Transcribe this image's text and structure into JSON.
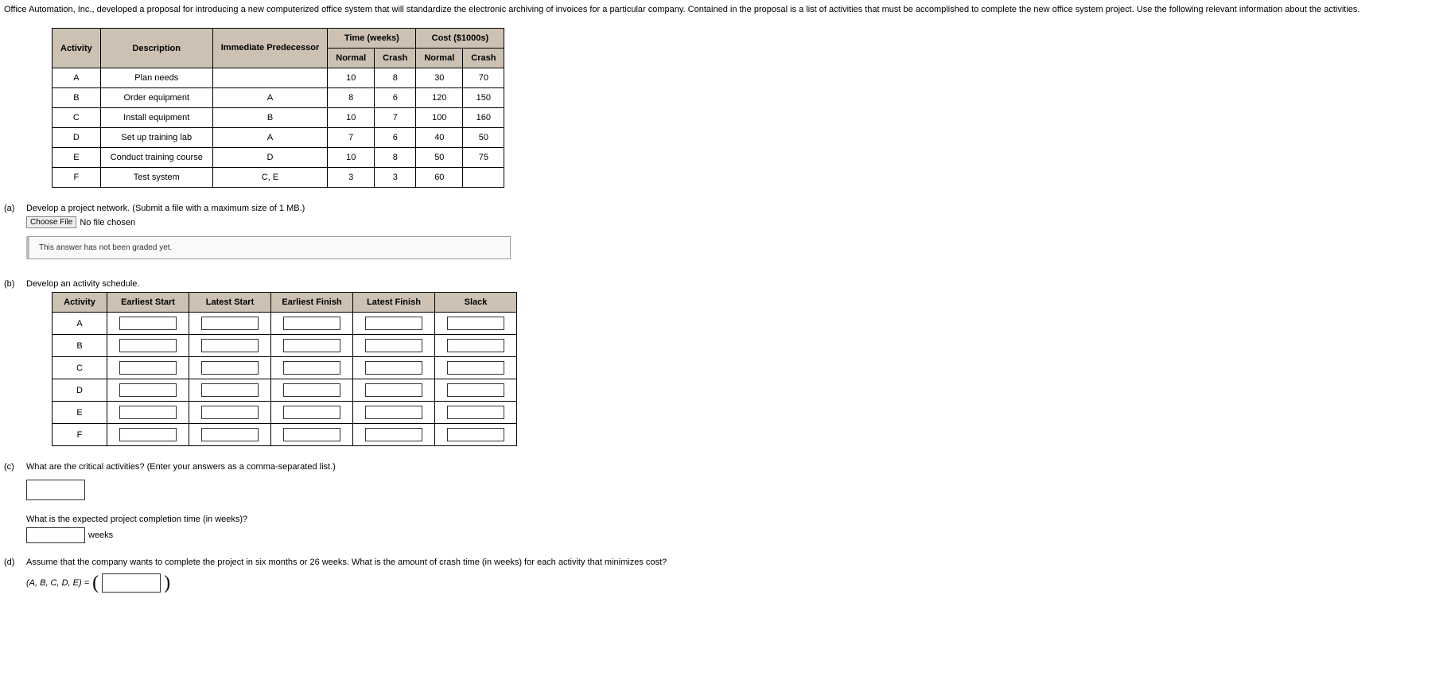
{
  "intro": "Office Automation, Inc., developed a proposal for introducing a new computerized office system that will standardize the electronic archiving of invoices for a particular company. Contained in the proposal is a list of activities that must be accomplished to complete the new office system project. Use the following relevant information about the activities.",
  "table1": {
    "time_header": "Time (weeks)",
    "cost_header": "Cost ($1000s)",
    "col_activity": "Activity",
    "col_description": "Description",
    "col_predecessor": "Immediate Predecessor",
    "col_normal": "Normal",
    "col_crash": "Crash",
    "rows": [
      {
        "act": "A",
        "desc": "Plan needs",
        "pred": "",
        "tn": "10",
        "tc": "8",
        "cn": "30",
        "cc": "70"
      },
      {
        "act": "B",
        "desc": "Order equipment",
        "pred": "A",
        "tn": "8",
        "tc": "6",
        "cn": "120",
        "cc": "150"
      },
      {
        "act": "C",
        "desc": "Install equipment",
        "pred": "B",
        "tn": "10",
        "tc": "7",
        "cn": "100",
        "cc": "160"
      },
      {
        "act": "D",
        "desc": "Set up training lab",
        "pred": "A",
        "tn": "7",
        "tc": "6",
        "cn": "40",
        "cc": "50"
      },
      {
        "act": "E",
        "desc": "Conduct training course",
        "pred": "D",
        "tn": "10",
        "tc": "8",
        "cn": "50",
        "cc": "75"
      },
      {
        "act": "F",
        "desc": "Test system",
        "pred": "C, E",
        "tn": "3",
        "tc": "3",
        "cn": "60",
        "cc": ""
      }
    ]
  },
  "a": {
    "label": "(a)",
    "text": "Develop a project network. (Submit a file with a maximum size of 1 MB.)",
    "choose_file": "Choose File",
    "no_file": "No file chosen",
    "graded_msg": "This answer has not been graded yet."
  },
  "b": {
    "label": "(b)",
    "text": "Develop an activity schedule.",
    "col_activity": "Activity",
    "col_es": "Earliest Start",
    "col_ls": "Latest Start",
    "col_ef": "Earliest Finish",
    "col_lf": "Latest Finish",
    "col_slack": "Slack",
    "activities": [
      "A",
      "B",
      "C",
      "D",
      "E",
      "F"
    ]
  },
  "c": {
    "label": "(c)",
    "text": "What are the critical activities? (Enter your answers as a comma-separated list.)",
    "sub": "What is the expected project completion time (in weeks)?",
    "weeks_unit": "weeks"
  },
  "d": {
    "label": "(d)",
    "text": "Assume that the company wants to complete the project in six months or 26 weeks. What is the amount of crash time (in weeks) for each activity that minimizes cost?",
    "tuple_label": "(A, B, C, D, E) ="
  }
}
